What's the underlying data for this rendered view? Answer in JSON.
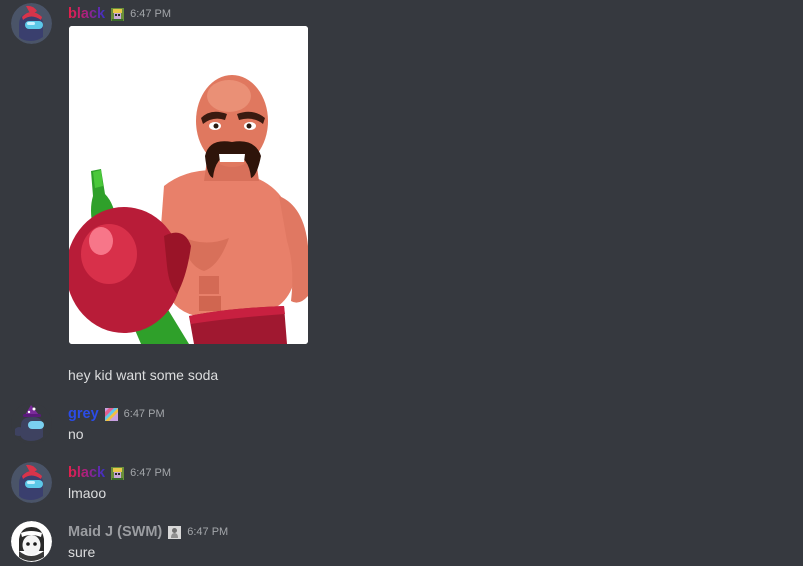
{
  "messages": [
    {
      "author": "black",
      "timestamp": "6:47 PM",
      "attachment": "image-wrestler-soda",
      "text": "hey kid want some soda"
    },
    {
      "author": "grey",
      "timestamp": "6:47 PM",
      "text": "no"
    },
    {
      "author": "black",
      "timestamp": "6:47 PM",
      "text": "lmaoo"
    },
    {
      "author": "Maid J (SWM)",
      "timestamp": "6:47 PM",
      "text": "sure"
    }
  ],
  "icons": {
    "black_badge": "pixel-creature-badge-icon",
    "grey_badge": "rainbow-cube-badge-icon",
    "maid_badge": "grey-figure-badge-icon"
  },
  "colors": {
    "background": "#36393f",
    "text": "#dcddde",
    "timestamp": "#a3a6aa",
    "grey_name": "#2b4ce8",
    "maid_name": "#9a9ca0"
  }
}
